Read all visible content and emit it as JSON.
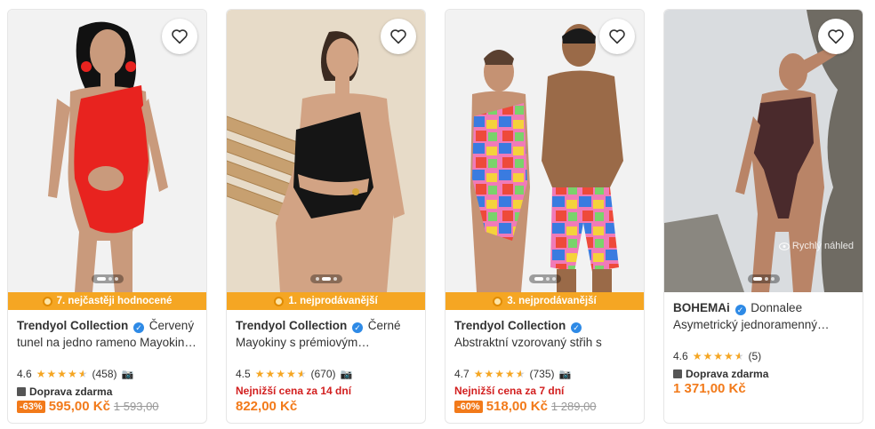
{
  "products": [
    {
      "brand": "Trendyol Collection",
      "name": "Červený tunel na jedno rameno Mayokin…",
      "badge": "7. nejčastěji hodnocené",
      "rating": "4.6",
      "rating_value": 4.6,
      "reviews": "(458)",
      "shipping": "Doprava zdarma",
      "discount": "-63%",
      "price": "595,00 Kč",
      "old_price": "1 593,00",
      "swimsuit_color": "#e8231f",
      "background_color": "#f2f2f2"
    },
    {
      "brand": "Trendyol Collection",
      "name": "Černé Mayokiny s prémiovým…",
      "badge": "1. nejprodávanější",
      "rating": "4.5",
      "rating_value": 4.5,
      "reviews": "(670)",
      "lowest_price_note": "Nejnižší cena za 14 dní",
      "price": "822,00 Kč",
      "swimsuit_color": "#151515",
      "background_color": "#e7dbc8"
    },
    {
      "brand": "Trendyol Collection",
      "name": "Abstraktní vzorovaný střih s detaily…",
      "badge": "3. nejprodávanější",
      "rating": "4.7",
      "rating_value": 4.7,
      "reviews": "(735)",
      "lowest_price_note": "Nejnižší cena za 7 dní",
      "discount": "-60%",
      "price": "518,00 Kč",
      "old_price": "1 289,00",
      "background_color": "#f2f2f2"
    },
    {
      "brand": "BOHEMAi",
      "name": "Donnalee Asymetrický jednoramenný…",
      "rating": "4.6",
      "rating_value": 4.6,
      "reviews": "(5)",
      "shipping": "Doprava zdarma",
      "price": "1 371,00 Kč",
      "quick_view": "Rychlý náhled",
      "swimsuit_color": "#4a2a2c",
      "background_color": "#d9dcdf"
    }
  ],
  "icons": {
    "favorite": "heart-icon",
    "verified": "verified-badge-icon",
    "review_photos": "camera-icon",
    "shipping": "box-icon",
    "badge": "medal-icon"
  },
  "colors": {
    "accent_orange": "#f27a1a",
    "badge_ribbon": "#f5a623",
    "star": "#f5a623",
    "lowest_price_red": "#d21f1f",
    "verified_blue": "#2e8ae6"
  }
}
